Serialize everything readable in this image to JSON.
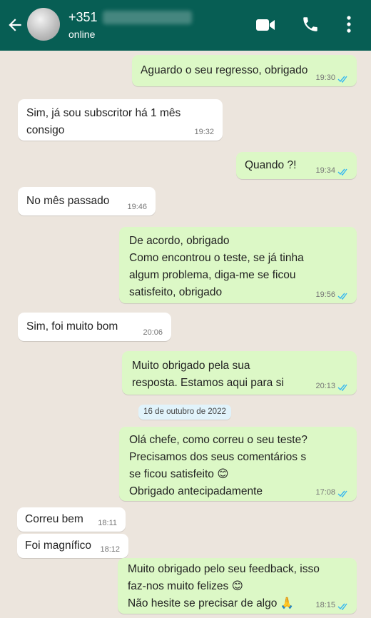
{
  "header": {
    "contact_name": "+351",
    "contact_status": "online"
  },
  "icons": {
    "back": "back-arrow-icon",
    "avatar": "contact-avatar",
    "video": "video-call-icon",
    "phone": "phone-call-icon",
    "menu": "more-vert-icon",
    "read": "double-check-read-icon"
  },
  "colors": {
    "header_bg": "#075e54",
    "chat_bg": "#ece5dd",
    "outgoing_bubble": "#dcf8c6",
    "incoming_bubble": "#ffffff",
    "read_ticks": "#34b7f1"
  },
  "date_divider": "16 de outubro de 2022",
  "messages": [
    {
      "dir": "out",
      "text": "Aguardo o seu regresso, obrigado",
      "time": "19:30"
    },
    {
      "dir": "in",
      "text": "Sim, já sou subscritor há 1 mês\nconsigo",
      "time": "19:32"
    },
    {
      "dir": "out",
      "text": "Quando ?!",
      "time": "19:34"
    },
    {
      "dir": "in",
      "text": "No mês passado",
      "time": "19:46"
    },
    {
      "dir": "out",
      "text": "De acordo, obrigado\nComo encontrou o teste, se já tinha\nalgum problema, diga-me se ficou\nsatisfeito, obrigado",
      "time": "19:56"
    },
    {
      "dir": "in",
      "text": "Sim, foi muito bom",
      "time": "20:06"
    },
    {
      "dir": "out",
      "text": "Muito obrigado pela sua\nresposta. Estamos aqui para si",
      "time": "20:13"
    },
    {
      "dir": "out",
      "text": "Olá chefe, como correu o seu teste?\nPrecisamos dos seus comentários s\nse ficou satisfeito 😊\nObrigado antecipadamente",
      "time": "17:08"
    },
    {
      "dir": "in",
      "text": "Correu bem",
      "time": "18:11"
    },
    {
      "dir": "in",
      "text": "Foi magnífico",
      "time": "18:12"
    },
    {
      "dir": "out",
      "text": "Muito obrigado pelo seu feedback, isso\nfaz-nos muito felizes 😊\nNão hesite se precisar de algo 🙏",
      "time": "18:15"
    }
  ]
}
